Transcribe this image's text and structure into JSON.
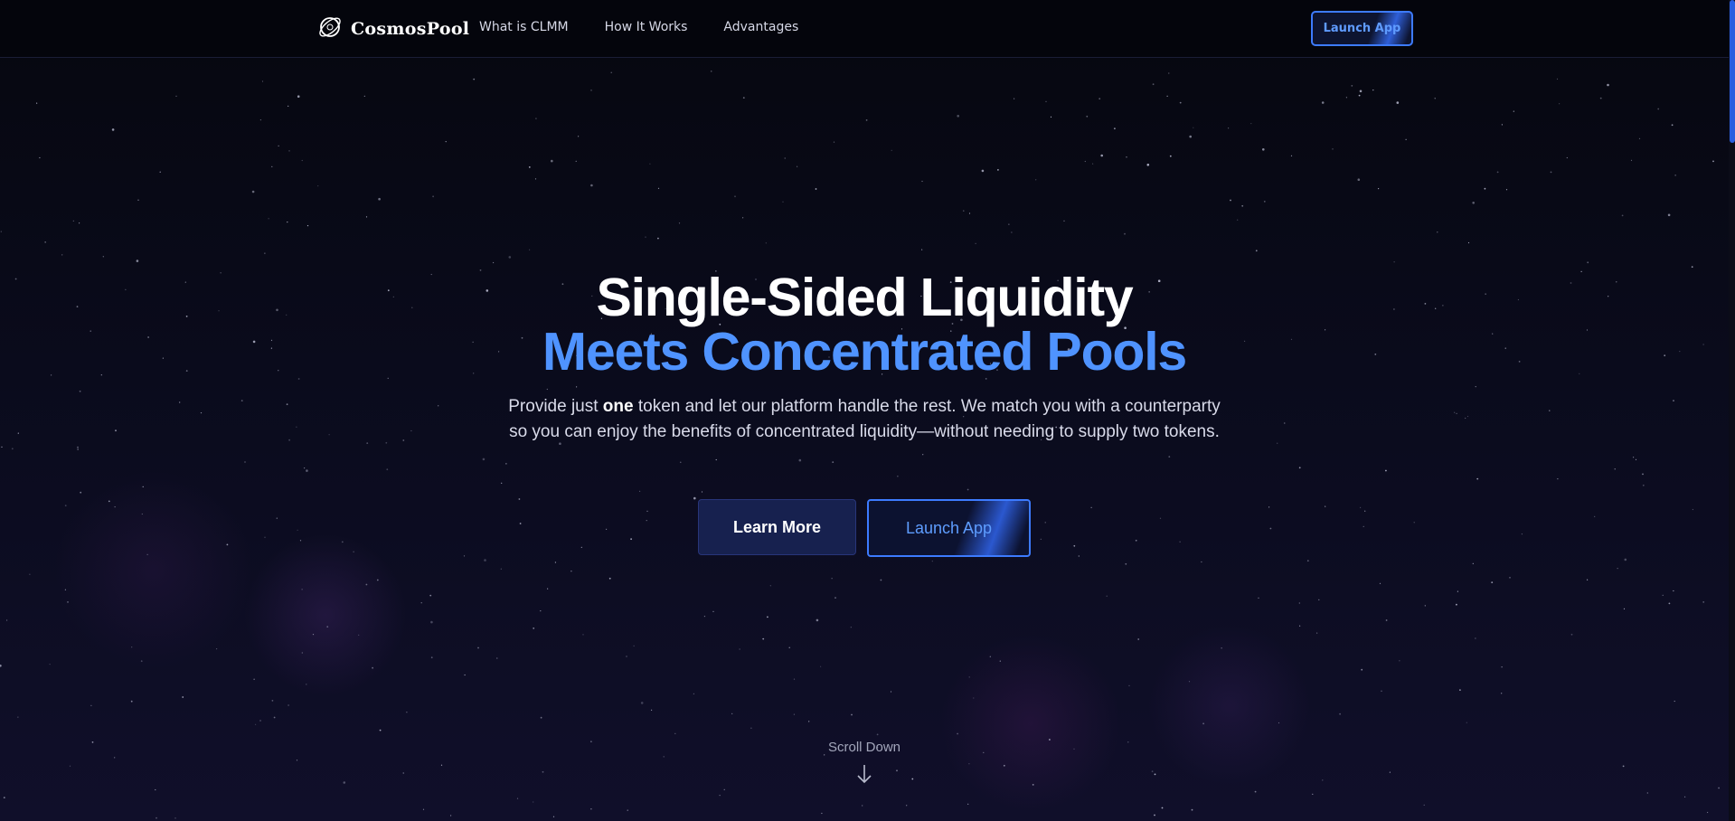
{
  "header": {
    "brand": "CosmosPool",
    "logo_icon": "planet-orbit-icon",
    "nav": [
      {
        "label": "What is CLMM"
      },
      {
        "label": "How It Works"
      },
      {
        "label": "Advantages"
      }
    ],
    "launch_label": "Launch App"
  },
  "hero": {
    "title_line1": "Single-Sided Liquidity",
    "title_line2": "Meets Concentrated Pools",
    "subtitle_before": "Provide just ",
    "subtitle_bold": "one",
    "subtitle_after": " token and let our platform handle the rest. We match you with a counterparty so you can enjoy the benefits of concentrated liquidity—without needing to supply two tokens.",
    "learn_more_label": "Learn More",
    "launch_label": "Launch App",
    "scroll_label": "Scroll Down",
    "scroll_icon": "arrow-down-icon"
  },
  "colors": {
    "accent": "#4f93ff",
    "background": "#070813",
    "button_primary": "#17214f",
    "border_accent": "#3d7bff"
  }
}
